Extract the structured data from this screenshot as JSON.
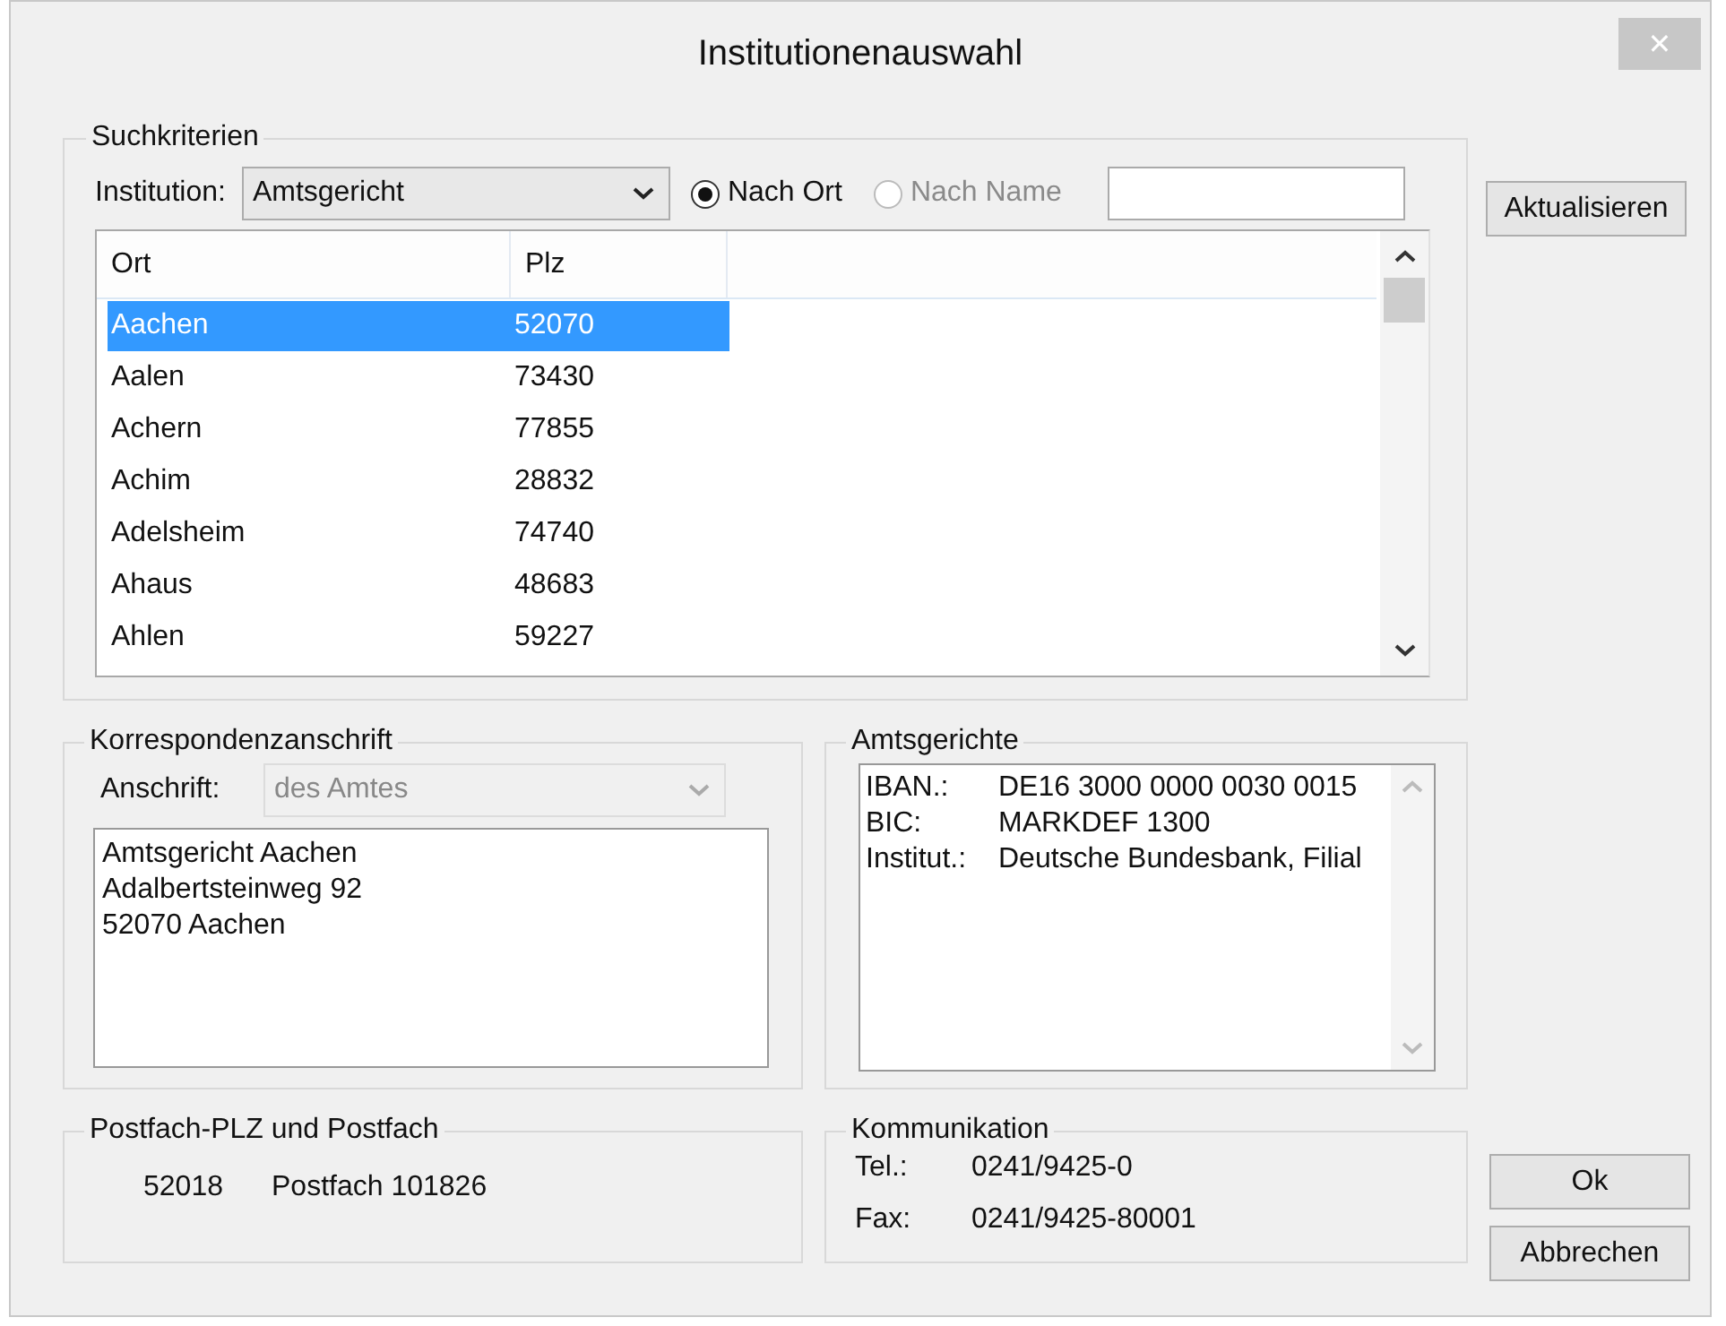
{
  "window": {
    "title": "Institutionenauswahl",
    "close": "✕"
  },
  "search": {
    "title": "Suchkriterien",
    "institution_label": "Institution:",
    "institution": {
      "value": "Amtsgericht",
      "disabled": false
    },
    "radios": [
      {
        "label": "Nach Ort",
        "selected": true,
        "disabled": false
      },
      {
        "label": "Nach Name",
        "selected": false,
        "disabled": true
      }
    ],
    "list": {
      "columns": [
        "Ort",
        "Plz"
      ],
      "rows": [
        {
          "cells": [
            "Aachen",
            "52070"
          ],
          "selected": true
        },
        {
          "cells": [
            "Aalen",
            "73430"
          ],
          "selected": false
        },
        {
          "cells": [
            "Achern",
            "77855"
          ],
          "selected": false
        },
        {
          "cells": [
            "Achim",
            "28832"
          ],
          "selected": false
        },
        {
          "cells": [
            "Adelsheim",
            "74740"
          ],
          "selected": false
        },
        {
          "cells": [
            "Ahaus",
            "48683"
          ],
          "selected": false
        },
        {
          "cells": [
            "Ahlen",
            "59227"
          ],
          "selected": false
        }
      ]
    }
  },
  "correspondence": {
    "title": "Korrespondenzanschrift",
    "label": "Anschrift:",
    "address": {
      "value": "des Amtes",
      "disabled": true
    },
    "lines": [
      "Amtsgericht Aachen",
      "Adalbertsteinweg 92",
      "52070 Aachen"
    ]
  },
  "bank": {
    "title": "Amtsgerichte",
    "rows": [
      {
        "label": "IBAN.:",
        "value": "DE16 3000 0000 0030 0015"
      },
      {
        "label": "BIC:",
        "value": "MARKDEF 1300"
      },
      {
        "label": "Institut.:",
        "value": "Deutsche Bundesbank, Filial"
      }
    ]
  },
  "postbox": {
    "title": "Postfach-PLZ und Postfach",
    "plz": "52018",
    "postfach": "Postfach 101826"
  },
  "communication": {
    "title": "Kommunikation",
    "rows": [
      {
        "label": "Tel.:",
        "value": "0241/9425-0"
      },
      {
        "label": "Fax:",
        "value": "0241/9425-80001"
      }
    ]
  },
  "buttons": {
    "refresh": "Aktualisieren",
    "ok": "Ok",
    "cancel": "Abbrechen"
  }
}
